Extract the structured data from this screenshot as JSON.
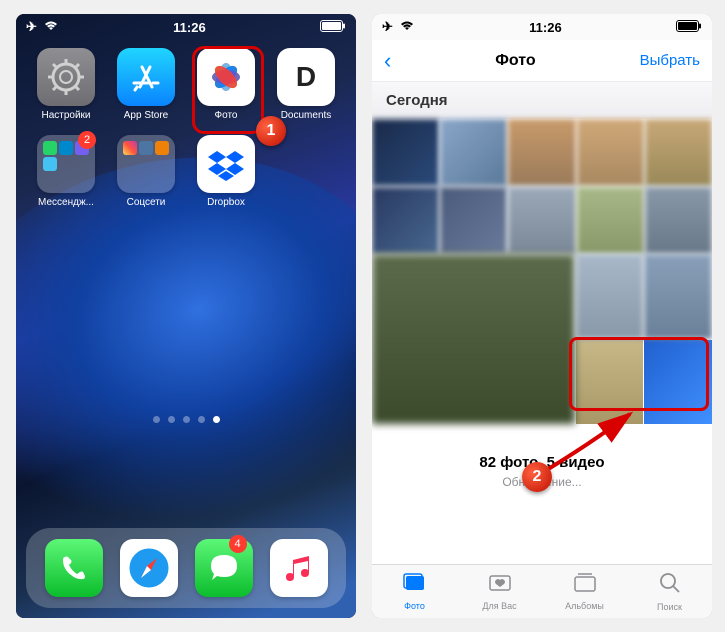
{
  "status": {
    "time": "11:26"
  },
  "home": {
    "apps": [
      {
        "label": "Настройки"
      },
      {
        "label": "App Store"
      },
      {
        "label": "Фото"
      },
      {
        "label": "Documents",
        "glyph": "D"
      }
    ],
    "folders": [
      {
        "label": "Мессендж...",
        "badge": "2"
      },
      {
        "label": "Соцсети"
      }
    ],
    "dropbox_label": "Dropbox",
    "dock_badge_messages": "4"
  },
  "photos": {
    "back_glyph": "‹",
    "title": "Фото",
    "select": "Выбрать",
    "section": "Сегодня",
    "summary_count": "82 фото, 5 видео",
    "summary_status": "Обновление...",
    "tabs": [
      {
        "label": "Фото"
      },
      {
        "label": "Для Вас"
      },
      {
        "label": "Альбомы"
      },
      {
        "label": "Поиск"
      }
    ]
  },
  "callouts": {
    "one": "1",
    "two": "2"
  }
}
